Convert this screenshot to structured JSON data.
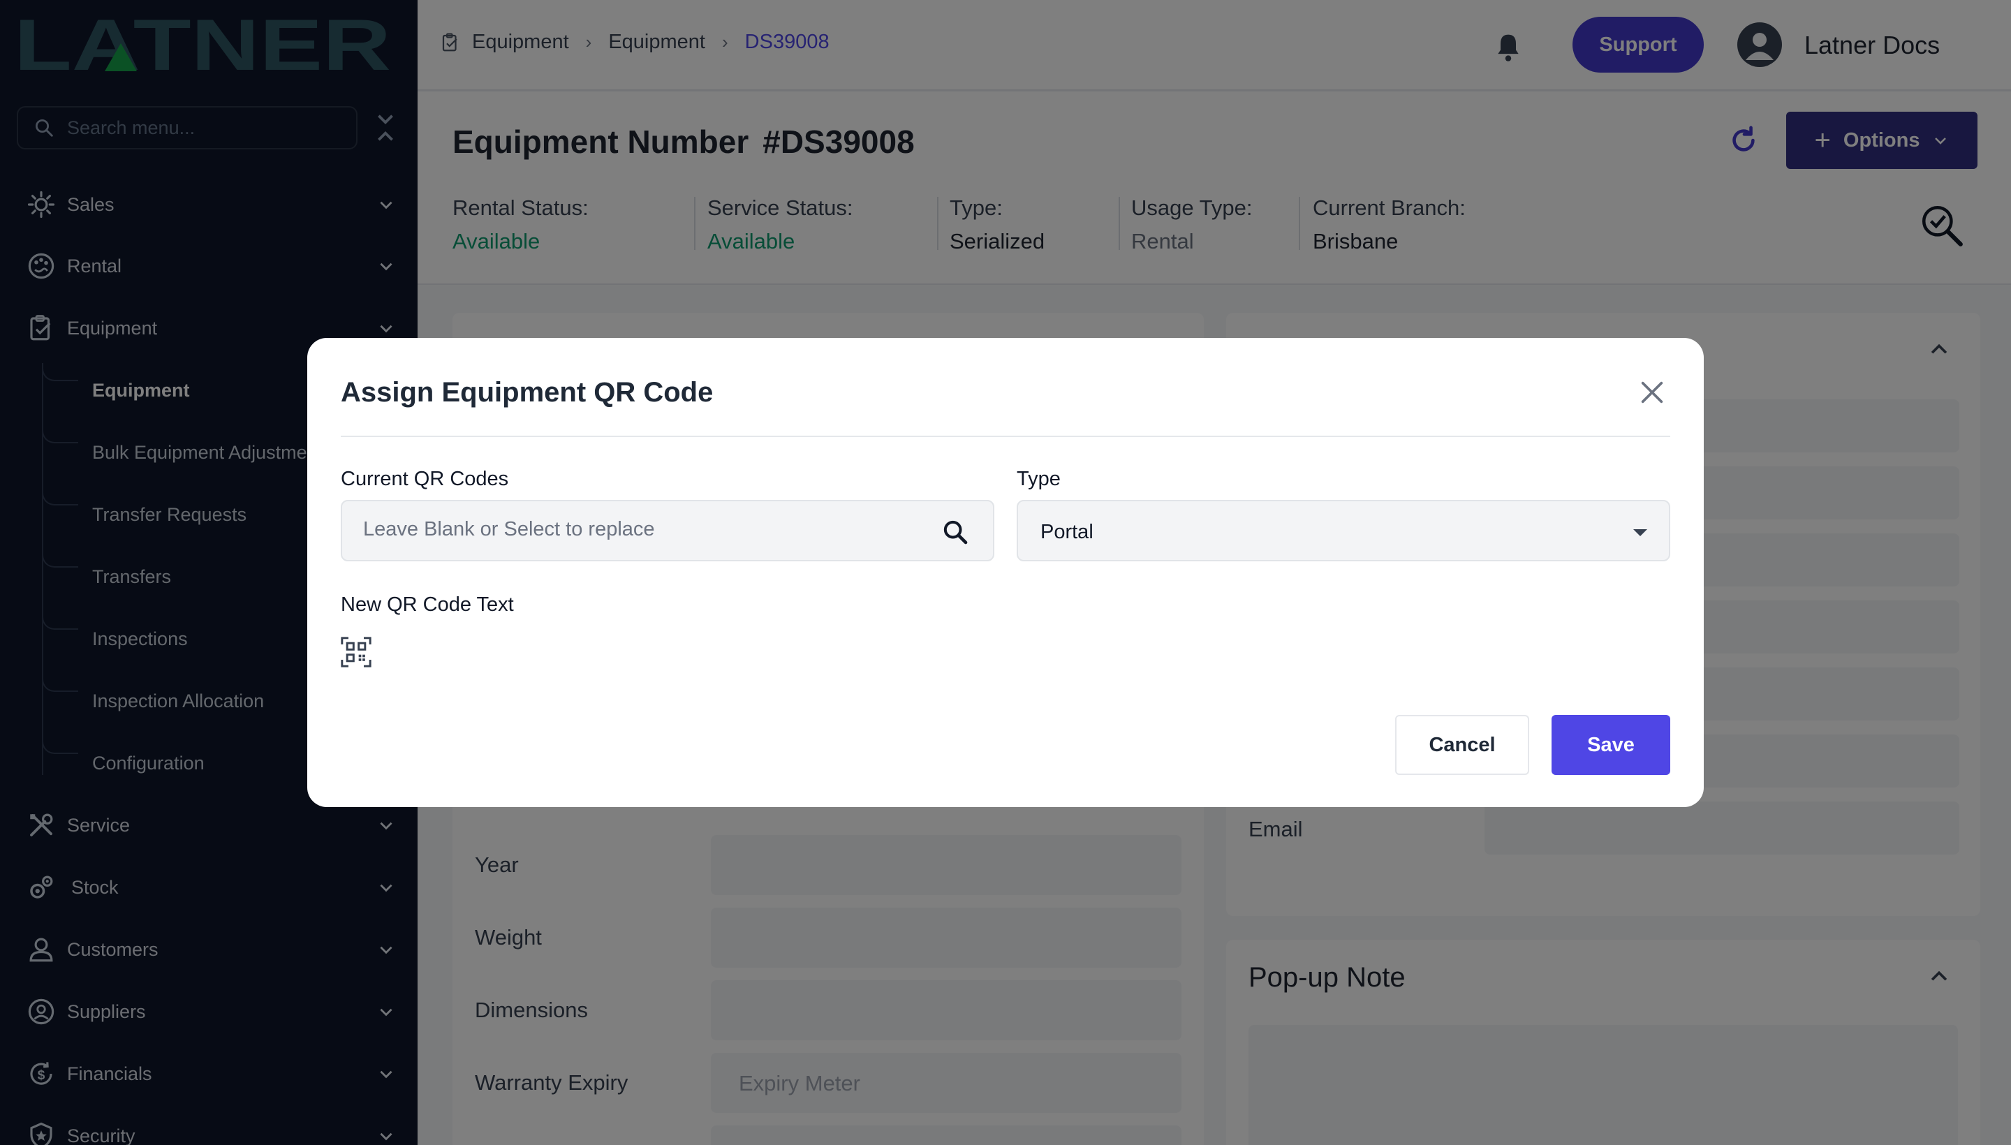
{
  "brand": {
    "logo_text": "LATNER",
    "accent": "#4f46e5",
    "sidebar_bg": "#0f172a"
  },
  "sidebar": {
    "search_placeholder": "Search menu...",
    "items": [
      {
        "label": "Sales",
        "icon": "sun-gear-icon"
      },
      {
        "label": "Rental",
        "icon": "palette-icon"
      },
      {
        "label": "Equipment",
        "icon": "clipboard-check-icon"
      },
      {
        "label": "Service",
        "icon": "tools-icon"
      },
      {
        "label": "Stock",
        "icon": "gears-icon"
      },
      {
        "label": "Customers",
        "icon": "user-icon"
      },
      {
        "label": "Suppliers",
        "icon": "supplier-icon"
      },
      {
        "label": "Financials",
        "icon": "dollar-cycle-icon"
      },
      {
        "label": "Security",
        "icon": "shield-star-icon"
      }
    ],
    "equipment_sub": [
      "Equipment",
      "Bulk Equipment Adjustments",
      "Transfer Requests",
      "Transfers",
      "Inspections",
      "Inspection Allocation",
      "Configuration"
    ]
  },
  "header": {
    "breadcrumbs": [
      "Equipment",
      "Equipment",
      "DS39008"
    ],
    "support_label": "Support",
    "user_name": "Latner Docs"
  },
  "page": {
    "title_prefix": "Equipment Number",
    "title_number": "#DS39008",
    "options_label": "Options",
    "stats": [
      {
        "label": "Rental Status:",
        "value": "Available",
        "status": "green"
      },
      {
        "label": "Service Status:",
        "value": "Available",
        "status": "green"
      },
      {
        "label": "Type:",
        "value": "Serialized",
        "status": "normal"
      },
      {
        "label": "Usage Type:",
        "value": "Rental",
        "status": "muted"
      },
      {
        "label": "Current Branch:",
        "value": "Brisbane",
        "status": "normal"
      }
    ]
  },
  "background": {
    "left_fields": [
      "Year",
      "Weight",
      "Dimensions",
      "Warranty Expiry"
    ],
    "warranty_placeholder": "Expiry Meter",
    "right_field_label": "Email",
    "popup_note_title": "Pop-up Note"
  },
  "modal": {
    "title": "Assign Equipment QR Code",
    "current_qr_label": "Current QR Codes",
    "current_qr_placeholder": "Leave Blank or Select to replace",
    "type_label": "Type",
    "type_value": "Portal",
    "new_qr_label": "New QR Code Text",
    "cancel_label": "Cancel",
    "save_label": "Save"
  }
}
